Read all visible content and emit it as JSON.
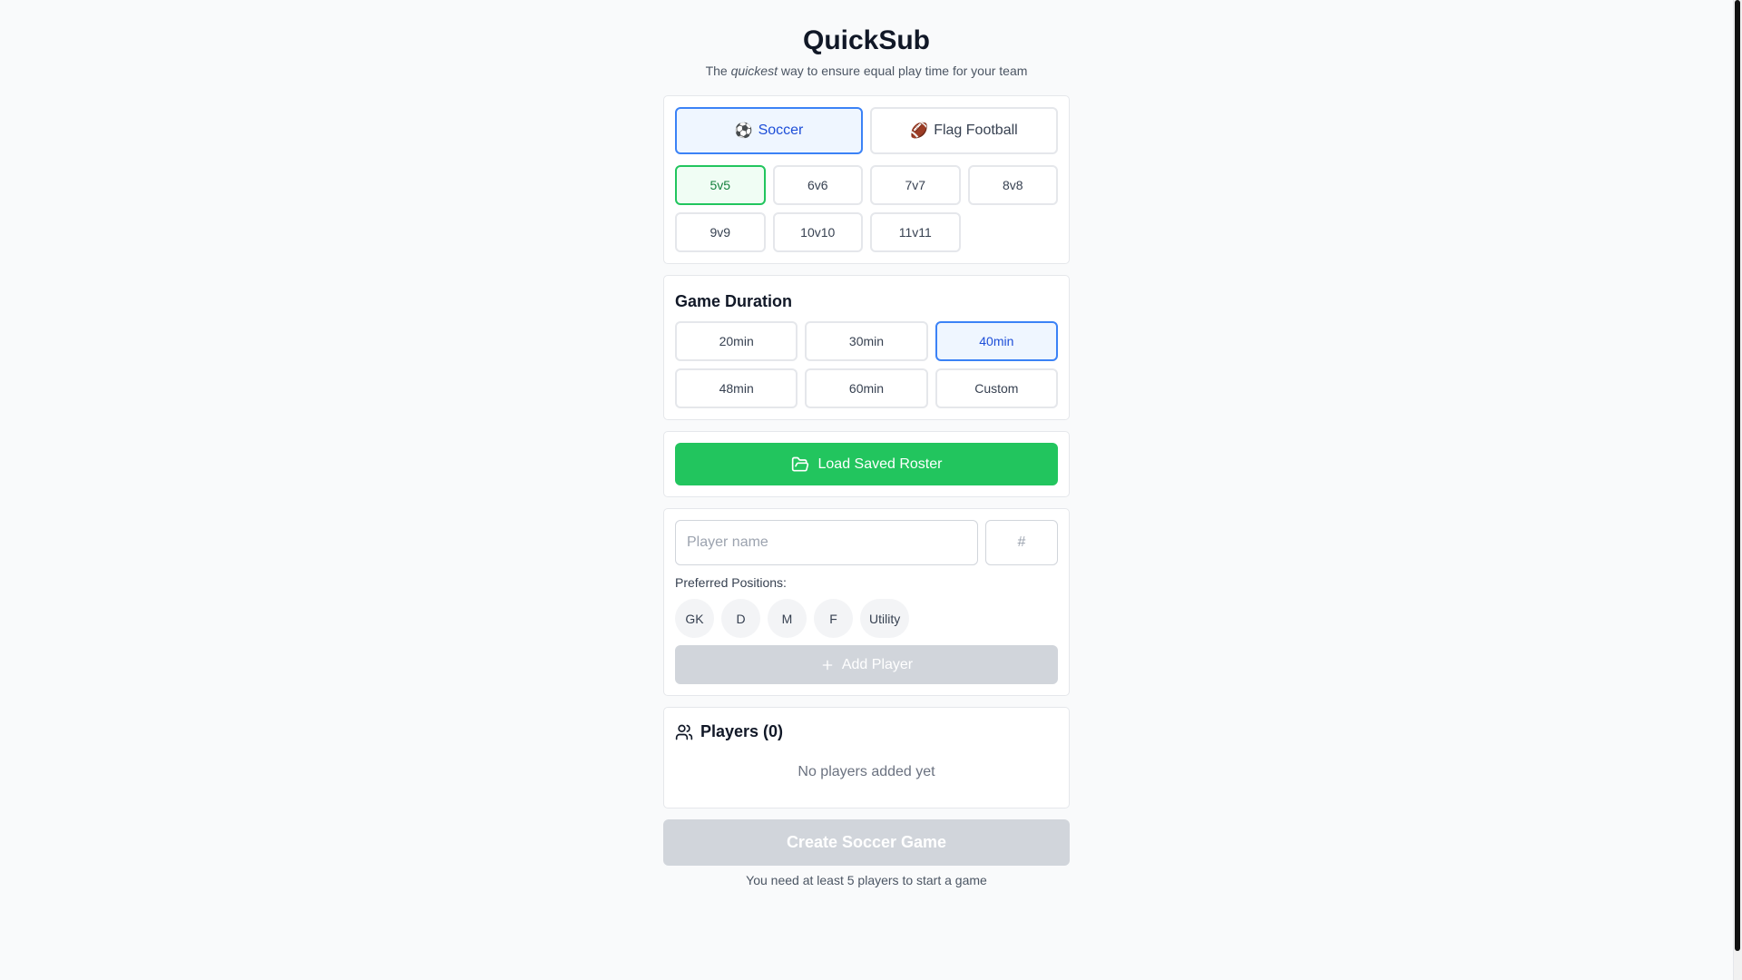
{
  "header": {
    "title": "QuickSub",
    "subtitle_pre": "The ",
    "subtitle_em": "quickest",
    "subtitle_post": " way to ensure equal play time for your team"
  },
  "sports": [
    {
      "icon": "⚽",
      "label": "Soccer",
      "selected": true
    },
    {
      "icon": "🏈",
      "label": "Flag Football",
      "selected": false
    }
  ],
  "formats": [
    "5v5",
    "6v6",
    "7v7",
    "8v8",
    "9v9",
    "10v10",
    "11v11"
  ],
  "selected_format": "5v5",
  "duration": {
    "title": "Game Duration",
    "options": [
      "20min",
      "30min",
      "40min",
      "48min",
      "60min",
      "Custom"
    ],
    "selected": "40min"
  },
  "load_roster": {
    "label": "Load Saved Roster",
    "icon": "folder-open-icon"
  },
  "player_form": {
    "name_placeholder": "Player name",
    "number_placeholder": "#",
    "positions_label": "Preferred Positions:",
    "positions": [
      "GK",
      "D",
      "M",
      "F",
      "Utility"
    ],
    "add_label": "Add Player"
  },
  "players": {
    "title": "Players (0)",
    "empty": "No players added yet",
    "icon": "users-icon"
  },
  "create": {
    "label": "Create Soccer Game",
    "hint": "You need at least 5 players to start a game"
  },
  "colors": {
    "primary_blue": "#3b82f6",
    "green": "#22c55e",
    "disabled": "#d1d5db",
    "background": "#f9fafb"
  }
}
